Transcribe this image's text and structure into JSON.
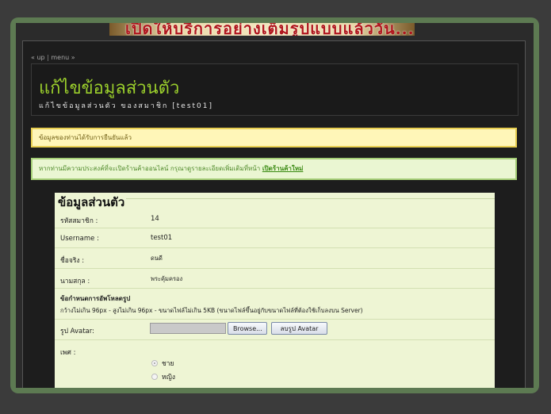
{
  "banner": {
    "text": "เปิดให้บริการอย่างเต็มรูปแบบแล้ววัน..."
  },
  "nav": {
    "up": "« up",
    "sep": "|",
    "menu": "menu »"
  },
  "header": {
    "title": "แก้ไขข้อมูลส่วนตัว",
    "subtitle": "แก้ไขข้อมูลส่วนตัว ของสมาชิก [test01]"
  },
  "notice": {
    "text": "ข้อมูลของท่านได้รับการยืนยันแล้ว"
  },
  "shop_notice": {
    "text": "หากท่านมีความประสงค์ที่จะเปิดร้านค้าออนไลน์ กรุณาดูรายละเอียดเพิ่มเติมที่หน้า ",
    "link": "เปิดร้านค้าใหม่"
  },
  "form": {
    "title": "ข้อมูลส่วนตัว",
    "fields": {
      "member_id": {
        "label": "รหัสสมาชิก :",
        "value": "14"
      },
      "username": {
        "label": "Username :",
        "value": "test01"
      },
      "firstname": {
        "label": "ชื่อจริง :",
        "value": "ดนดี"
      },
      "lastname": {
        "label": "นามสกุล :",
        "value": "พระคุ้มครอง"
      }
    },
    "upload_note": {
      "title": "ข้อกำหนดการอัพโหลดรูป",
      "text": "กว้างไม่เกิน 96px - สูงไม่เกิน 96px - ขนาดไฟล์ไม่เกิน 5KB (ขนาดไฟล์ขึ้นอยู่กับขนาดไฟล์ที่ต้องใช้เก็บลงบน Server)"
    },
    "avatar": {
      "label": "รูป Avatar:",
      "browse": "Browse...",
      "delete": "ลบรูป Avatar"
    },
    "gender": {
      "label": "เพศ :",
      "options": [
        "ชาย",
        "หญิง"
      ],
      "selected": "ชาย"
    }
  }
}
